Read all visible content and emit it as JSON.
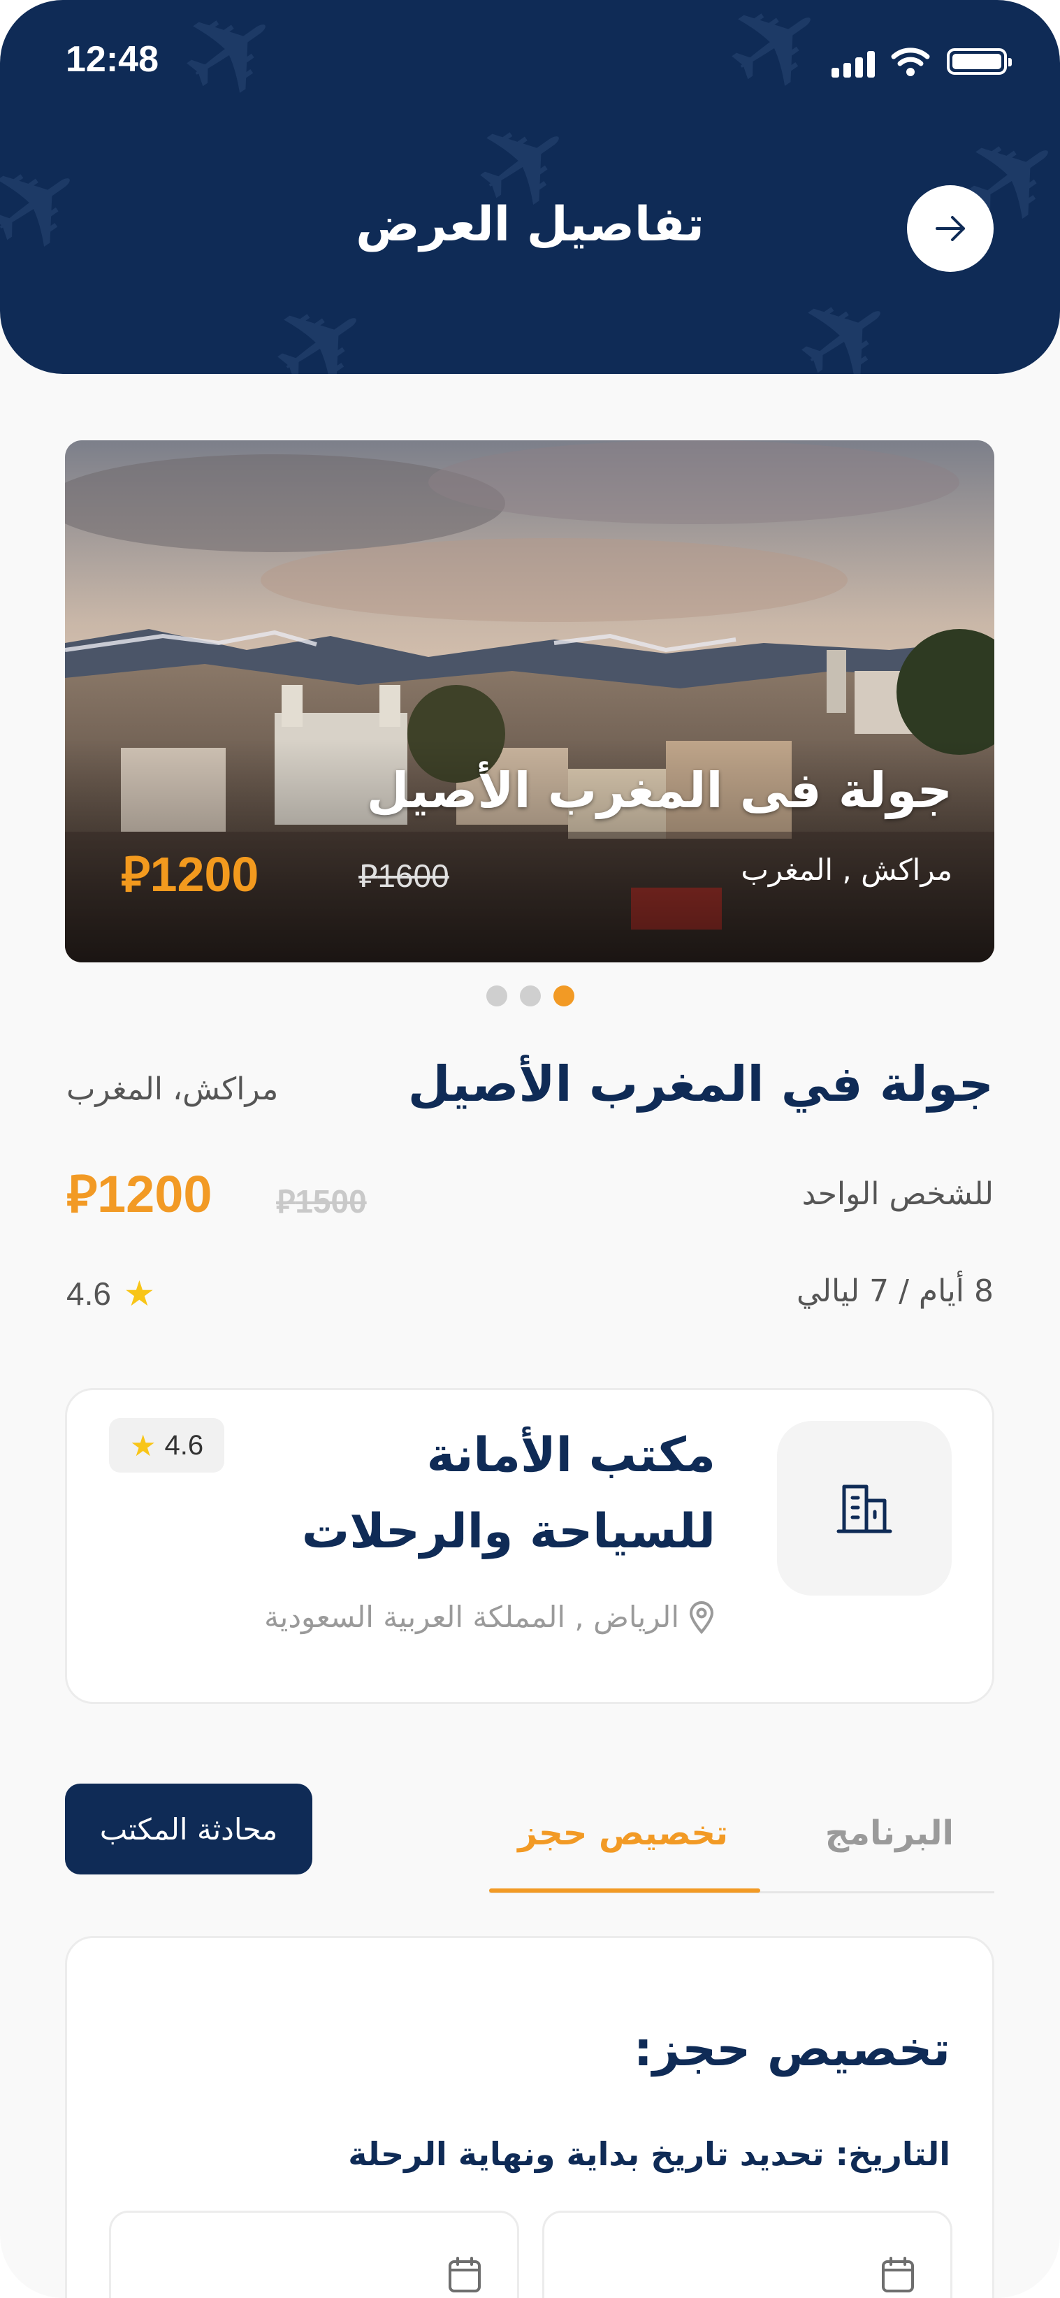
{
  "status_bar": {
    "time": "12:48"
  },
  "header": {
    "title": "تفاصيل العرض",
    "back_icon": "arrow-right-icon"
  },
  "hero": {
    "title": "جولة فى المغرب الأصيل",
    "location": "مراكش , المغرب",
    "price": "1200",
    "old_price": "1600",
    "currency_icon": "riyal-icon",
    "carousel": {
      "count": 3,
      "active_index": 2
    }
  },
  "trip": {
    "title": "جولة في المغرب الأصيل",
    "location": "مراكش، المغرب",
    "per_person": "للشخص الواحد",
    "price": "1200",
    "old_price": "1500",
    "duration": "8 أيام / 7 ليالي",
    "rating": "4.6"
  },
  "office": {
    "name": "مكتب الأمانة للسياحة والرحلات",
    "rating": "4.6",
    "location": "الرياض , المملكة العربية السعودية",
    "icon": "building-icon"
  },
  "tabs": [
    {
      "label": "البرنامج",
      "active": false
    },
    {
      "label": "تخصيص حجز",
      "active": true
    }
  ],
  "chat_button": "محادثة المكتب",
  "customization": {
    "title": "تخصيص حجز:",
    "date_label": "التاريخ: تحديد تاريخ بداية ونهاية الرحلة"
  },
  "colors": {
    "navy": "#0f2b56",
    "accent": "#f29a25",
    "star": "#f8c518"
  }
}
